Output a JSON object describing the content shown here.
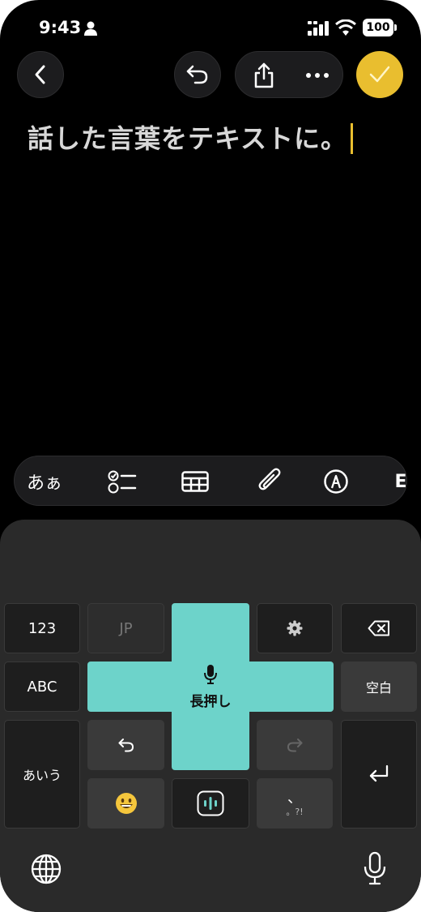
{
  "status": {
    "time": "9:43",
    "battery": "100"
  },
  "note": {
    "text": "話した言葉をテキストに。"
  },
  "format_bar": {
    "text_style_label": "あぁ",
    "more_label": "E"
  },
  "keyboard": {
    "num_key": "123",
    "jp_key": "JP",
    "abc_key": "ABC",
    "space_key": "空白",
    "kana_key": "あいう",
    "voice_label": "長押し",
    "punct_main": "、",
    "punct_sub": "。?!"
  },
  "colors": {
    "accent": "#e9be2f",
    "teal": "#6dd3ca",
    "background": "#000000"
  },
  "icons": [
    "back-icon",
    "undo-icon",
    "share-icon",
    "more-icon",
    "checkmark-icon",
    "checklist-icon",
    "table-icon",
    "paperclip-icon",
    "markup-icon",
    "gear-icon",
    "delete-icon",
    "undo-icon",
    "redo-icon",
    "emoji-icon",
    "waveform-icon",
    "return-icon",
    "globe-icon",
    "microphone-icon"
  ]
}
